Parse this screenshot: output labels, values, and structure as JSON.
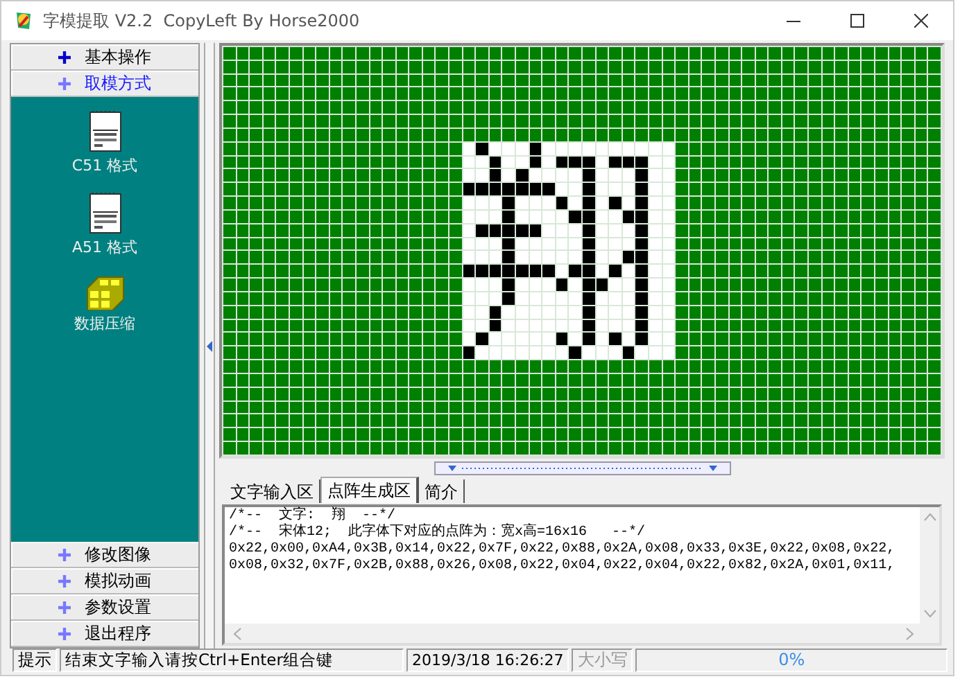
{
  "window": {
    "title": "字模提取 V2.2  CopyLeft By Horse2000"
  },
  "sidebar": {
    "top_items": [
      {
        "label": "基本操作",
        "selected": false
      },
      {
        "label": "取模方式",
        "selected": true
      }
    ],
    "tools": [
      {
        "label": "C51 格式",
        "kind": "c51"
      },
      {
        "label": "A51 格式",
        "kind": "a51"
      },
      {
        "label": "数据压缩",
        "kind": "compress"
      }
    ],
    "bottom_items": [
      {
        "label": "修改图像",
        "selected": false
      },
      {
        "label": "模拟动画",
        "selected": false
      },
      {
        "label": "参数设置",
        "selected": false
      },
      {
        "label": "退出程序",
        "selected": false
      }
    ]
  },
  "tabs": [
    {
      "label": "文字输入区",
      "selected": false
    },
    {
      "label": "点阵生成区",
      "selected": true
    },
    {
      "label": "简介",
      "selected": false
    }
  ],
  "output_lines": [
    "/*--  文字:  翔  --*/",
    "/*--  宋体12;  此字体下对应的点阵为：宽x高=16x16   --*/",
    "0x22,0x00,0xA4,0x3B,0x14,0x22,0x7F,0x22,0x88,0x2A,0x08,0x33,0x3E,0x22,0x08,0x22,",
    "0x08,0x32,0x7F,0x2B,0x88,0x26,0x08,0x22,0x04,0x22,0x04,0x22,0x82,0x2A,0x01,0x11,"
  ],
  "status_bar": {
    "label": "提示",
    "message": "结束文字输入请按Ctrl+Enter组合键",
    "datetime": "2019/3/18 16:26:27",
    "caps": {
      "text": "大小写",
      "on": false
    },
    "progress": "0%"
  }
}
